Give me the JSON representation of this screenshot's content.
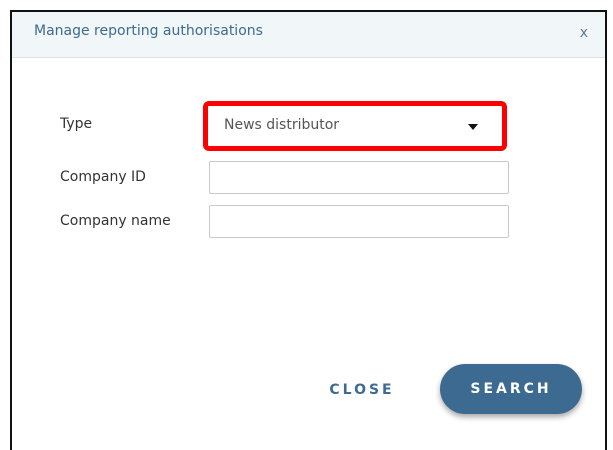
{
  "dialog": {
    "title": "Manage reporting authorisations",
    "close_glyph": "x"
  },
  "form": {
    "type": {
      "label": "Type",
      "selected": "News distributor",
      "caret_icon": "caret-down-icon"
    },
    "company_id": {
      "label": "Company ID",
      "value": "",
      "placeholder": ""
    },
    "company_name": {
      "label": "Company name",
      "value": "",
      "placeholder": ""
    }
  },
  "actions": {
    "close_label": "CLOSE",
    "search_label": "SEARCH"
  },
  "colors": {
    "accent": "#3d6a90",
    "highlight": "#ff0000",
    "header_bg": "#f1f6f9"
  }
}
